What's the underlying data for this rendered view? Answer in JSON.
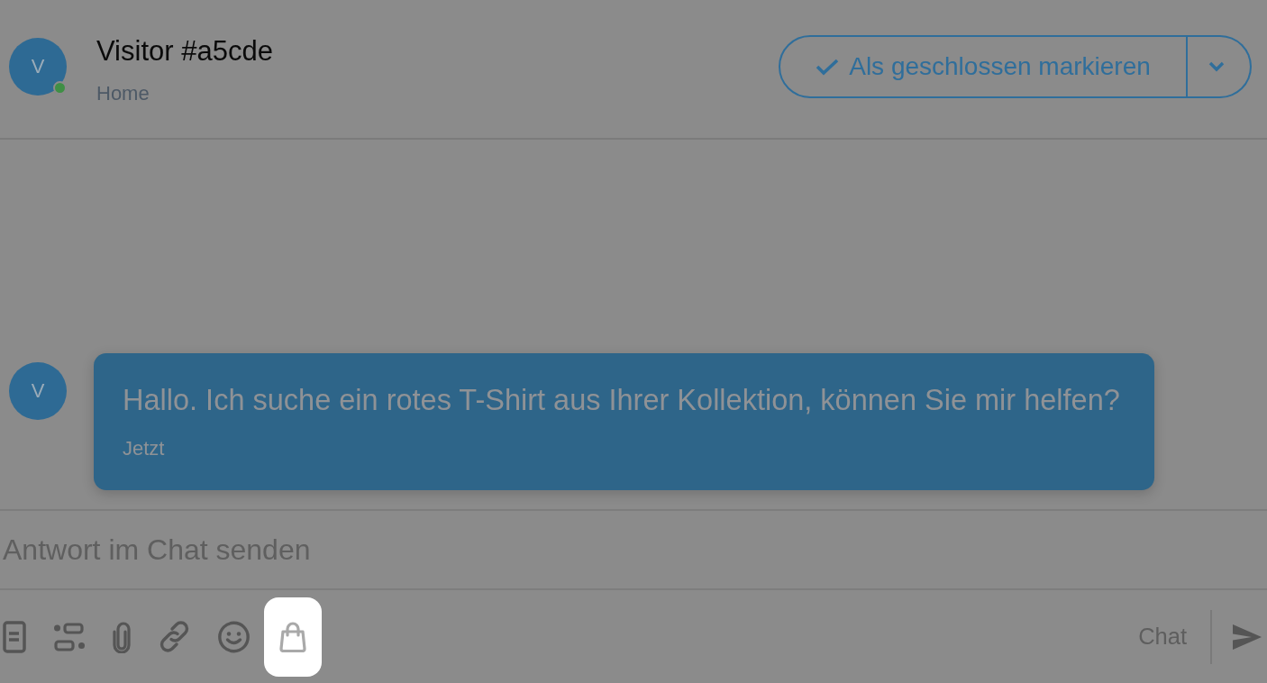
{
  "conversation": {
    "avatar": "V",
    "title": "Visitor #a5cde",
    "subtitle": "Home",
    "online": true,
    "close_label": "Als geschlossen markieren"
  },
  "messages": [
    {
      "avatar": "V",
      "text": "Hallo. Ich suche ein rotes T-Shirt aus Ihrer Kollektion, können Sie mir helfen?",
      "time": "Jetzt"
    }
  ],
  "composer": {
    "placeholder": "Antwort im Chat senden",
    "tools": [
      {
        "kind": "document",
        "highlighted": false
      },
      {
        "kind": "quick-replies",
        "highlighted": false
      },
      {
        "kind": "attachment",
        "highlighted": false
      },
      {
        "kind": "link",
        "highlighted": false
      },
      {
        "kind": "emoji",
        "highlighted": false
      },
      {
        "kind": "product",
        "highlighted": true
      }
    ],
    "channel": "Chat"
  }
}
